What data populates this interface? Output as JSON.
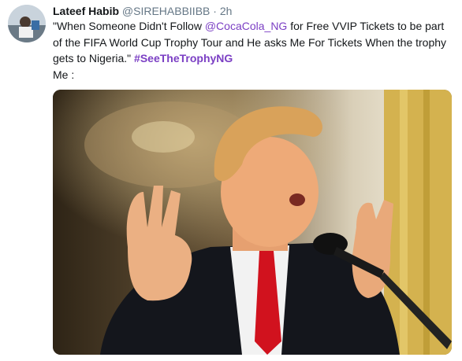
{
  "tweet": {
    "author_name": "Lateef Habib",
    "author_handle": "@SIREHABBIIBB",
    "separator": "·",
    "timestamp": "2h",
    "text_part1": "\"When Someone Didn't Follow ",
    "mention": "@CocaCola_NG",
    "text_part2": " for Free VVIP Tickets to be part of the FIFA World Cup Trophy Tour and He asks Me For Tickets When the trophy gets to Nigeria.\" ",
    "hashtag": "#SeeTheTrophyNG",
    "text_line_last": "Me :"
  },
  "colors": {
    "link": "#7b3fc4",
    "meta": "#657786",
    "text": "#14171a"
  },
  "icons": {
    "avatar": "profile-photo",
    "media": "photo-man-gesturing-at-microphone"
  }
}
